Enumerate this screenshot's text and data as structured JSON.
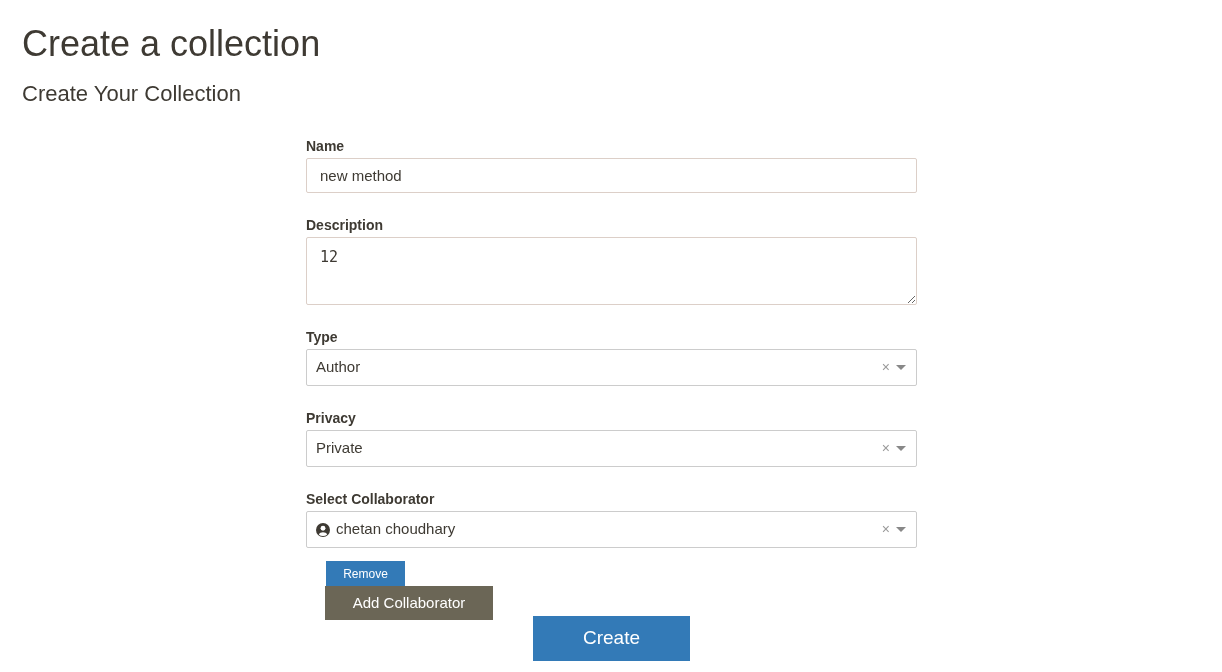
{
  "title": "Create a collection",
  "subtitle": "Create Your Collection",
  "fields": [
    {
      "kind": "text",
      "label": "Name",
      "value": "new method"
    },
    {
      "kind": "textarea",
      "label": "Description",
      "value": "12"
    },
    {
      "kind": "select",
      "label": "Type",
      "value": "Author",
      "clear": "×"
    },
    {
      "kind": "select",
      "label": "Privacy",
      "value": "Private",
      "clear": "×"
    },
    {
      "kind": "user-select",
      "label": "Select Collaborator",
      "value": "chetan choudhary",
      "clear": "×"
    }
  ],
  "remove_button": "Remove",
  "add_button": "Add Collaborator",
  "create_button": "Create"
}
